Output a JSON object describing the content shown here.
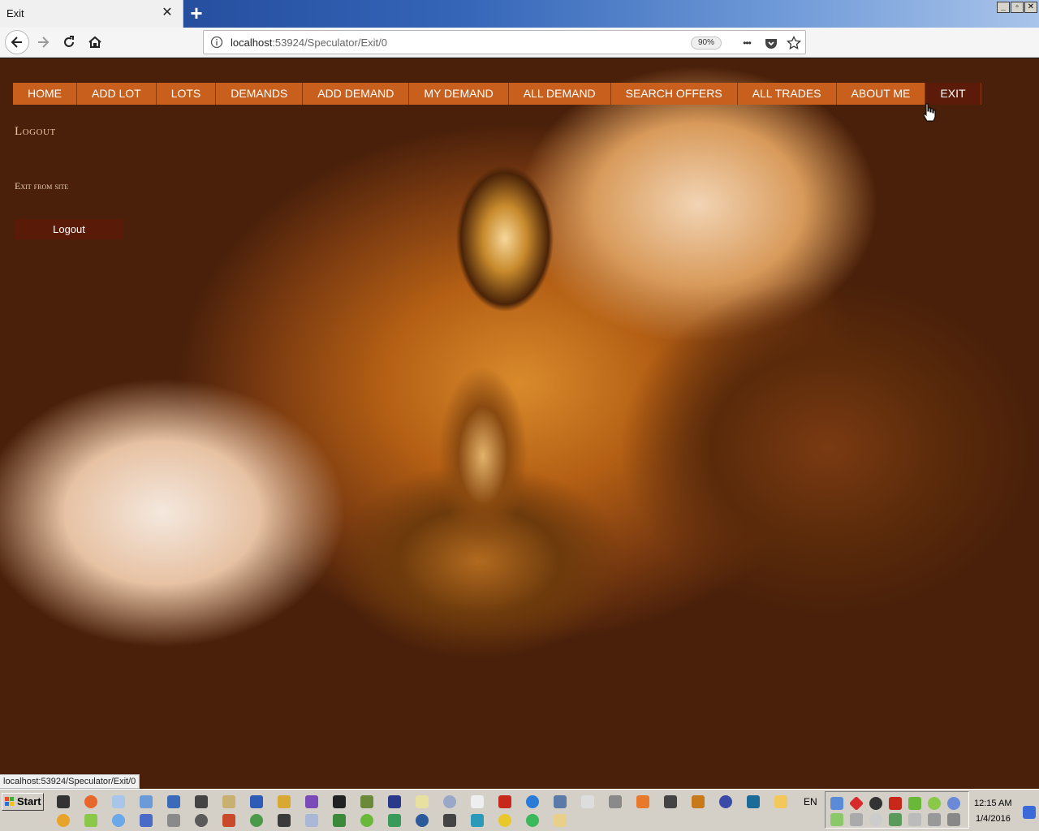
{
  "browser": {
    "tab_title": "Exit",
    "tab_close": "✕",
    "new_tab": "+",
    "url_host": "localhost",
    "url_rest": ":53924/Speculator/Exit/0",
    "zoom": "90%",
    "more": "•••"
  },
  "window_controls": {
    "minimize": "_",
    "maximize": "▫",
    "close": "✕"
  },
  "site_nav": {
    "items": [
      {
        "label": "HOME",
        "active": false
      },
      {
        "label": "ADD LOT",
        "active": false
      },
      {
        "label": "LOTS",
        "active": false
      },
      {
        "label": "DEMANDS",
        "active": false
      },
      {
        "label": "ADD DEMAND",
        "active": false
      },
      {
        "label": "MY DEMAND",
        "active": false
      },
      {
        "label": "ALL DEMAND",
        "active": false
      },
      {
        "label": "SEARCH OFFERS",
        "active": false
      },
      {
        "label": "ALL TRADES",
        "active": false
      },
      {
        "label": "ABOUT ME",
        "active": false
      },
      {
        "label": "EXIT",
        "active": true
      }
    ]
  },
  "page": {
    "title": "Logout",
    "subtitle": "Exit from site",
    "logout_button": "Logout"
  },
  "status_bar": {
    "link": "localhost:53924/Speculator/Exit/0"
  },
  "taskbar": {
    "start": "Start",
    "language": "EN",
    "time": "12:15 AM",
    "date": "1/4/2016"
  },
  "colors": {
    "menu_bg": "#c85f1c",
    "menu_active": "#5c1a08",
    "logout_bg": "#5a1a08"
  }
}
